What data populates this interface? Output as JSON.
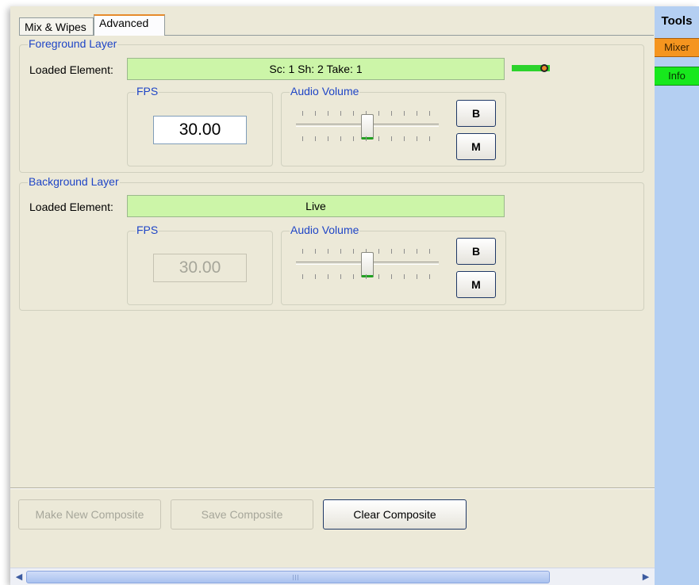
{
  "tabs": [
    {
      "label": "Mix & Wipes",
      "selected": false
    },
    {
      "label": "Advanced",
      "selected": true
    }
  ],
  "foreground": {
    "title": "Foreground Layer",
    "loaded_label": "Loaded Element:",
    "loaded_value": "Sc: 1 Sh: 2 Take: 1",
    "fps_label": "FPS",
    "fps_value": "30.00",
    "audio_label": "Audio Volume",
    "audio_level": 0.5,
    "btn_b": "B",
    "btn_m": "M"
  },
  "background": {
    "title": "Background Layer",
    "loaded_label": "Loaded Element:",
    "loaded_value": "Live",
    "fps_label": "FPS",
    "fps_value": "30.00",
    "audio_label": "Audio Volume",
    "audio_level": 0.5,
    "btn_b": "B",
    "btn_m": "M"
  },
  "actions": {
    "make_new": "Make New Composite",
    "save": "Save Composite",
    "clear": "Clear Composite"
  },
  "tools": {
    "title": "Tools",
    "mixer": "Mixer",
    "info": "Info"
  },
  "colors": {
    "legend": "#1f45c6",
    "loaded_bg": "#ccf5a8",
    "mixer": "#f5951f",
    "info": "#17e81d",
    "tools_bg": "#b4cff2"
  },
  "icons": {
    "scroll_left": "chevron-left-icon",
    "scroll_right": "chevron-right-icon"
  }
}
